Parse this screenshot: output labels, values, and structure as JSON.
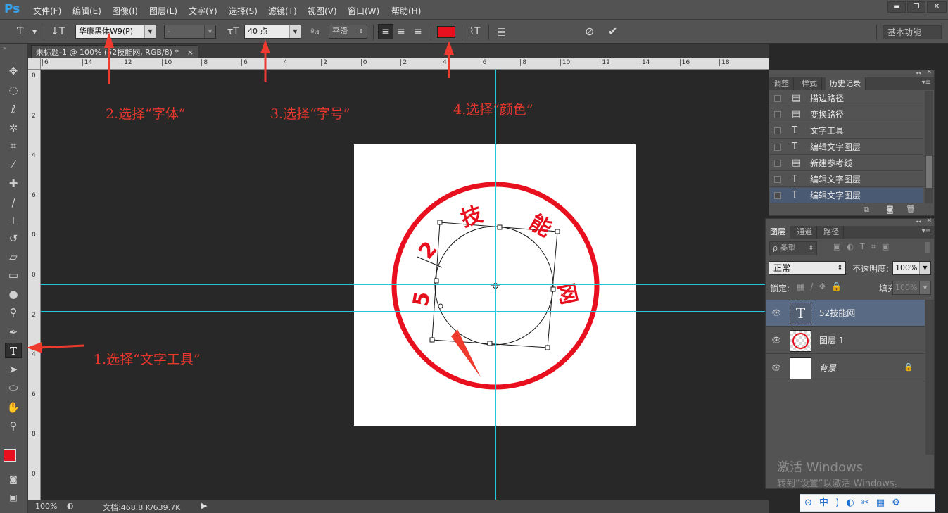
{
  "app": {
    "logo": "Ps"
  },
  "menu": [
    "文件(F)",
    "编辑(E)",
    "图像(I)",
    "图层(L)",
    "文字(Y)",
    "选择(S)",
    "滤镜(T)",
    "视图(V)",
    "窗口(W)",
    "帮助(H)"
  ],
  "window_buttons": {
    "minimize": "▬",
    "restore": "❐",
    "close": "✕"
  },
  "options": {
    "font_family": "华康黑体W9(P)",
    "font_style": "-",
    "font_size": "40 点",
    "antialias_icon": "ªa",
    "antialias": "平滑",
    "text_color": "#e8101e",
    "workspace": "基本功能"
  },
  "document_tab": {
    "title": "未标题-1 @ 100% (52技能网, RGB/8) *",
    "close": "×"
  },
  "ruler_h_labels": [
    "6",
    "14",
    "12",
    "10",
    "8",
    "6",
    "4",
    "2",
    "0",
    "2",
    "4",
    "6",
    "8",
    "10",
    "12",
    "14",
    "16",
    "18"
  ],
  "ruler_v_labels": [
    "0",
    "2",
    "4",
    "6",
    "8",
    "0",
    "2",
    "4",
    "6",
    "8",
    "0"
  ],
  "status": {
    "zoom": "100%",
    "doc_info": "文档:468.8 K/639.7K"
  },
  "history_panel": {
    "tabs": [
      "调整",
      "样式",
      "历史记录"
    ],
    "active_tab": "历史记录",
    "items": [
      {
        "icon": "▤",
        "label": "描边路径"
      },
      {
        "icon": "▤",
        "label": "变换路径"
      },
      {
        "icon": "T",
        "label": "文字工具"
      },
      {
        "icon": "T",
        "label": "编辑文字图层"
      },
      {
        "icon": "▤",
        "label": "新建参考线"
      },
      {
        "icon": "T",
        "label": "编辑文字图层"
      },
      {
        "icon": "T",
        "label": "编辑文字图层"
      }
    ]
  },
  "layers_panel": {
    "tabs": [
      "图层",
      "通道",
      "路径"
    ],
    "active_tab": "图层",
    "filter_label": "ρ 类型",
    "blend_mode": "正常",
    "opacity_label": "不透明度:",
    "opacity_value": "100%",
    "lock_label": "锁定:",
    "fill_label": "填充:",
    "fill_value": "100%",
    "layers": [
      {
        "name": "52技能网",
        "type": "text"
      },
      {
        "name": "图层 1",
        "type": "raster"
      },
      {
        "name": "背景",
        "type": "background"
      }
    ]
  },
  "stamp": {
    "color": "#e8101e",
    "chars": [
      "5",
      "2",
      "技",
      "能",
      "网"
    ]
  },
  "annotations": [
    {
      "label": "1.选择“文字工具”"
    },
    {
      "label": "2.选择“字体”"
    },
    {
      "label": "3.选择“字号”"
    },
    {
      "label": "4.选择“颜色”"
    }
  ],
  "watermark": {
    "line1": "激活 Windows",
    "line2": "转到“设置”以激活 Windows。"
  },
  "ime_bar": "中 ) ◐ ✂ ▦ ⚙"
}
